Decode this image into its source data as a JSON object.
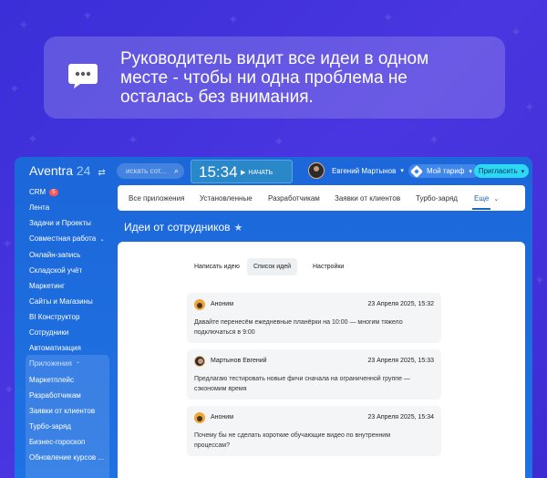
{
  "callout": {
    "icon": "speech-bubble-icon",
    "line1": "Руководитель видит все идеи в одном",
    "line2": "месте - чтобы ни одна проблема не",
    "line3": "осталась без внимания."
  },
  "topbar": {
    "logo_text": "Aventra",
    "logo_number": "24",
    "logo_switch": "⇄",
    "search_placeholder": "искать сот...",
    "clock_time": "15:34",
    "clock_start": "НАЧАТЬ",
    "user_name": "Евгений Мартынов",
    "tariff_label": "Мой тариф",
    "invite_label": "Пригласить"
  },
  "sidebar": {
    "crm_label": "CRM",
    "crm_badge": "5",
    "items": [
      "Лента",
      "Задачи и Проекты",
      "Совместная работа",
      "Онлайн-запись",
      "Складской учёт",
      "Маркетинг",
      "Сайты и Магазины",
      "BI Конструктор",
      "Сотрудники",
      "Автоматизация"
    ],
    "group_title": "Приложения",
    "group_items": [
      "Маркетплейс",
      "Разработчикам",
      "Заявки от клиентов",
      "Турбо-заряд",
      "Бизнес-гороскоп",
      "Обновление курсов ..."
    ]
  },
  "tabs": [
    "Все приложения",
    "Установленные",
    "Разработчикам",
    "Заявки от клиентов",
    "Турбо-заряд",
    "Еще"
  ],
  "page_title": "Идеи от сотрудников",
  "subtabs": [
    "Написать идею",
    "Список идей",
    "Настройки"
  ],
  "ideas": [
    {
      "author": "Аноним",
      "date": "23 Апреля 2025, 15:32",
      "line1": "Давайте перенесём ежедневные планёрки на 10:00 — многим тяжело",
      "line2": "подключаться в 9:00"
    },
    {
      "author": "Мартынов Евгений",
      "date": "23 Апреля 2025, 15:33",
      "line1": "Предлагаю тестировать новые фичи сначала на ограниченной группе —",
      "line2": "сэкономим время"
    },
    {
      "author": "Аноним",
      "date": "23 Апреля 2025, 15:34",
      "line1": "Почему бы не сделать короткие обучающие видео по внутренним",
      "line2": "процессам?"
    }
  ]
}
